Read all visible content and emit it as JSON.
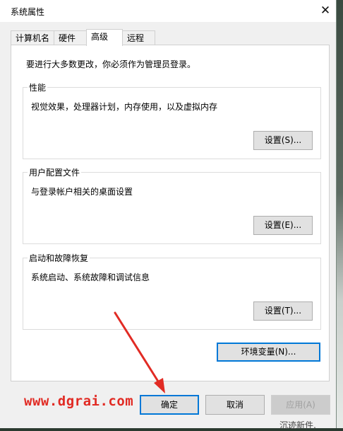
{
  "window": {
    "title": "系统属性",
    "close_glyph": "✕"
  },
  "tabs": [
    {
      "label": "计算机名",
      "active": false
    },
    {
      "label": "硬件",
      "active": false
    },
    {
      "label": "高级",
      "active": true
    },
    {
      "label": "远程",
      "active": false
    }
  ],
  "advanced": {
    "intro": "要进行大多数更改，你必须作为管理员登录。",
    "performance": {
      "title": "性能",
      "description": "视觉效果，处理器计划，内存使用，以及虚拟内存",
      "button_label": "设置(S)..."
    },
    "user_profiles": {
      "title": "用户配置文件",
      "description": "与登录帐户相关的桌面设置",
      "button_label": "设置(E)..."
    },
    "startup_recovery": {
      "title": "启动和故障恢复",
      "description": "系统启动、系统故障和调试信息",
      "button_label": "设置(T)..."
    },
    "env_button_label": "环境变量(N)..."
  },
  "buttons": {
    "ok": "确定",
    "cancel": "取消",
    "apply": "应用(A)"
  },
  "watermark": "www.dgrai.com",
  "annotation_color": "#e12b24",
  "background_fragment_text": "沉迹新件,"
}
